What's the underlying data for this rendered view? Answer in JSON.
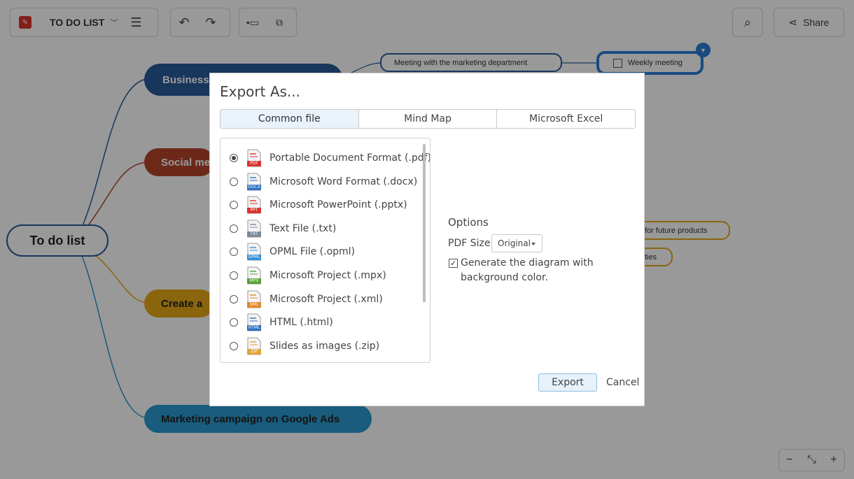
{
  "app": {
    "document_title": "TO DO LIST",
    "share_label": "Share"
  },
  "mindmap": {
    "root": "To do list",
    "branches": [
      "Business",
      "Social me",
      "Create a",
      "Marketing campaign on Google Ads"
    ],
    "subnodes": [
      "Meeting with the marketing department",
      "Weekly meeting",
      "for future products",
      "ties"
    ]
  },
  "dialog": {
    "title": "Export As...",
    "tabs": [
      {
        "label": "Common file",
        "active": true
      },
      {
        "label": "Mind Map",
        "active": false
      },
      {
        "label": "Microsoft Excel",
        "active": false
      }
    ],
    "formats": [
      {
        "label": "Portable Document Format (.pdf)",
        "icon": "pdf-file-icon",
        "badge": "PDF",
        "color": "#d9342b",
        "selected": true
      },
      {
        "label": "Microsoft Word Format (.docx)",
        "icon": "docx-file-icon",
        "badge": "DOCX",
        "color": "#2f6fc0",
        "selected": false
      },
      {
        "label": "Microsoft PowerPoint (.pptx)",
        "icon": "pptx-file-icon",
        "badge": "PPT",
        "color": "#d9342b",
        "selected": false
      },
      {
        "label": "Text File (.txt)",
        "icon": "txt-file-icon",
        "badge": "TXT",
        "color": "#7a8a99",
        "selected": false
      },
      {
        "label": "OPML File (.opml)",
        "icon": "opml-file-icon",
        "badge": "OPML",
        "color": "#2f8fd8",
        "selected": false
      },
      {
        "label": "Microsoft Project (.mpx)",
        "icon": "mpx-file-icon",
        "badge": "MPX",
        "color": "#5aa13a",
        "selected": false
      },
      {
        "label": "Microsoft Project (.xml)",
        "icon": "xml-file-icon",
        "badge": "XML",
        "color": "#e08a2a",
        "selected": false
      },
      {
        "label": "HTML (.html)",
        "icon": "html-file-icon",
        "badge": "HTML",
        "color": "#2f6fc0",
        "selected": false
      },
      {
        "label": "Slides as images (.zip)",
        "icon": "zip-file-icon",
        "badge": "ZIP",
        "color": "#e0a63a",
        "selected": false
      }
    ],
    "options": {
      "title": "Options",
      "pdf_size_label": "PDF Size",
      "pdf_size_value": "Original",
      "background_checked": true,
      "background_label": "Generate the diagram with background color."
    },
    "export_label": "Export",
    "cancel_label": "Cancel"
  },
  "colors": {
    "business": "#2a5a9a",
    "social": "#b5452c",
    "create": "#e6a817",
    "marketing": "#2a9ad0",
    "overlay": "rgba(0,0,0,0.4)"
  }
}
